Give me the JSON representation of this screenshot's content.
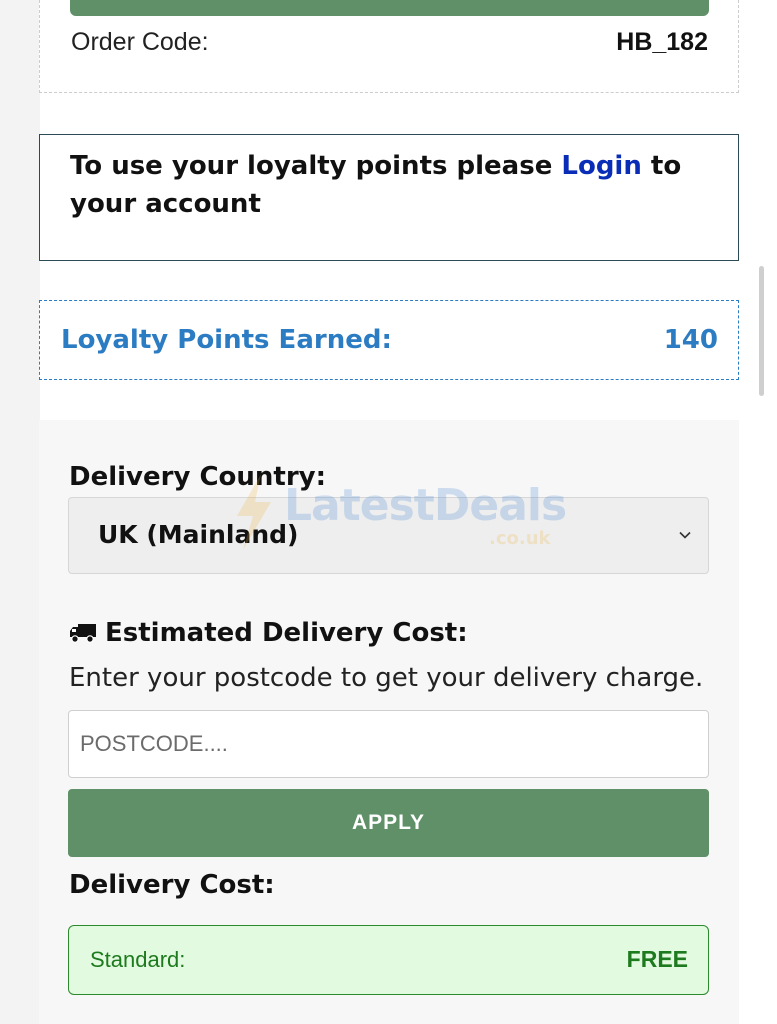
{
  "order": {
    "label": "Order Code:",
    "value": "HB_182"
  },
  "login_prompt": {
    "before": "To use your loyalty points please ",
    "link": "Login",
    "after": " to your account"
  },
  "loyalty": {
    "label": "Loyalty Points Earned:",
    "value": "140"
  },
  "delivery": {
    "country_label": "Delivery Country:",
    "country_selected": "UK (Mainland)",
    "estimate_label": "Estimated Delivery Cost:",
    "estimate_help": "Enter your postcode to get your delivery charge.",
    "postcode_placeholder": "POSTCODE....",
    "apply_label": "APPLY",
    "cost_label": "Delivery Cost:",
    "cost_name": "Standard:",
    "cost_value": "FREE"
  },
  "watermark": {
    "text": "LatestDeals",
    "sub": ".co.uk"
  },
  "icons": {
    "truck": "truck-icon",
    "chevron": "chevron-down-icon"
  },
  "colors": {
    "brand_green": "#5f9068",
    "link_blue": "#0a2db8",
    "loyalty_blue": "#2b7cc2",
    "success_green": "#1e7a1e",
    "success_bg": "#e2fadf"
  }
}
